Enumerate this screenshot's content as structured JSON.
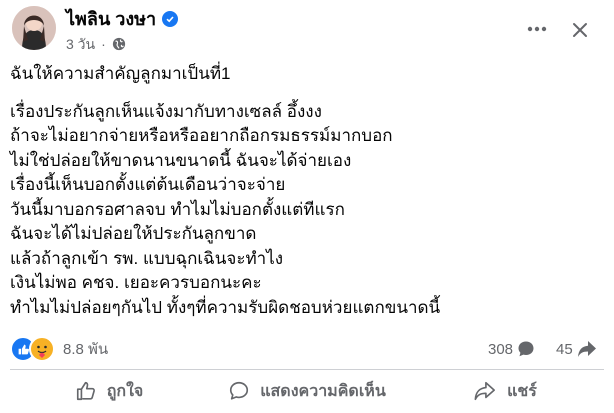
{
  "post": {
    "author": "ไพลิน วงษา",
    "time": "3 วัน",
    "lines": [
      "ฉันให้ความสำคัญลูกมาเป็นที่1",
      "",
      "เรื่องประกันลูกเห็นแจ้งมากับทางเซลล์ อึ้งงง",
      "ถ้าจะไม่อยากจ่ายหรือหรืออยากถือกรมธรรม์มากบอก",
      "ไม่ใช่ปล่อยให้ขาดนานขนาดนี้ ฉันจะได้จ่ายเอง",
      "เรื่องนี้เห็นบอกตั้งแต่ต้นเดือนว่าจะจ่าย",
      "วันนี้มาบอกรอศาลจบ ทำไมไม่บอกตั้งแต่ทีแรก",
      "ฉันจะได้ไม่ปล่อยให้ประกันลูกขาด",
      "แล้วถ้าลูกเข้า รพ. แบบฉุกเฉินจะทำไง",
      "เงินไม่พอ คชจ. เยอะควรบอกนะคะ",
      "ทำไมไม่ปล่อยๆกันไป ทั้งๆที่ความรับผิดชอบห่วยแตกขนาดนี้"
    ]
  },
  "stats": {
    "reactions": "8.8 พัน",
    "comments": "308",
    "shares": "45"
  },
  "actions": {
    "like": "ถูกใจ",
    "comment": "แสดงความคิดเห็น",
    "share": "แชร์"
  },
  "colors": {
    "brand_blue": "#1877f2",
    "secondary_text": "#65676b"
  },
  "icons": [
    "verified-badge-icon",
    "globe-icon",
    "more-options-icon",
    "close-icon",
    "like-reaction-icon",
    "care-reaction-icon",
    "comment-icon",
    "share-icon",
    "thumbs-up-icon"
  ]
}
